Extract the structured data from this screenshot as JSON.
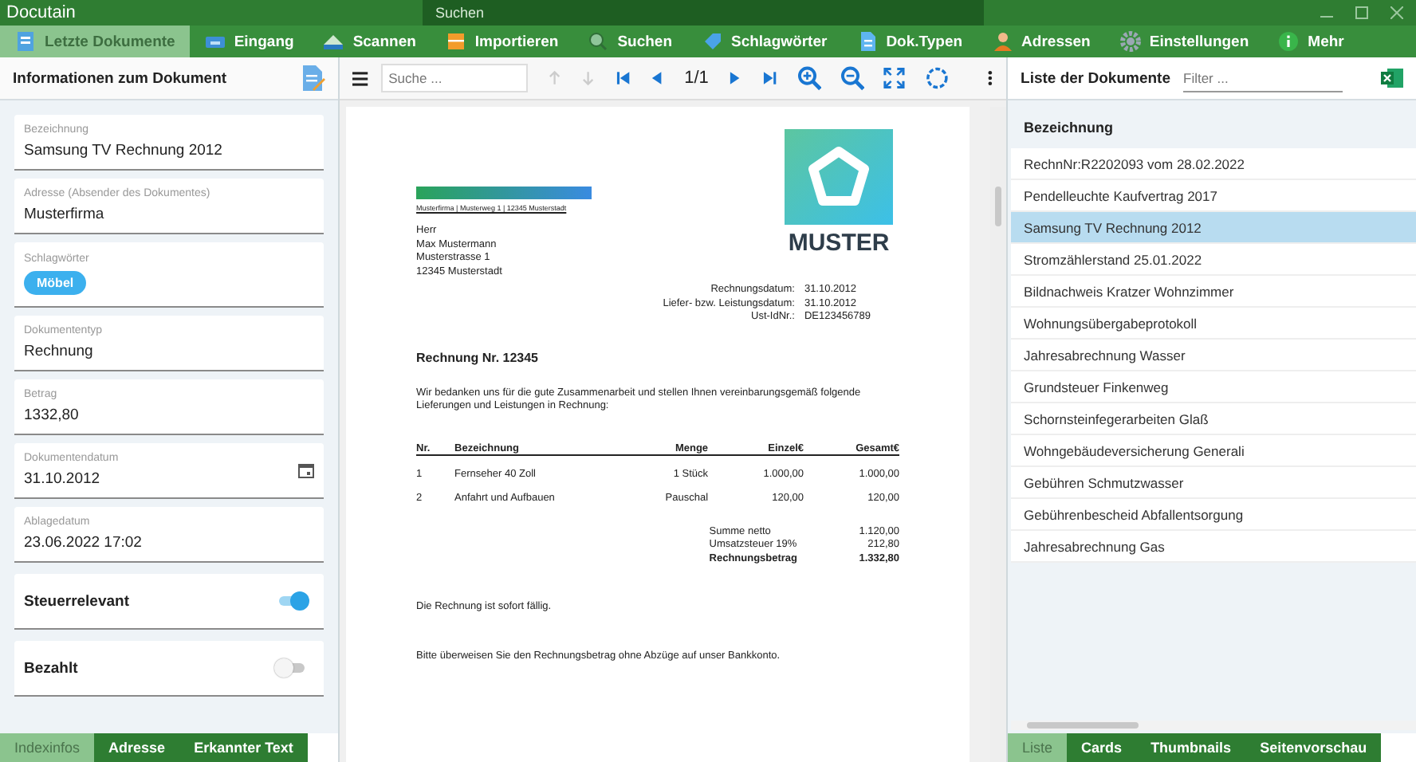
{
  "app": {
    "logo": "Docutain",
    "search_placeholder": "Suchen"
  },
  "menu": [
    {
      "label": "Letzte Dokumente",
      "selected": true
    },
    {
      "label": "Eingang",
      "selected": false
    },
    {
      "label": "Scannen",
      "selected": false
    },
    {
      "label": "Importieren",
      "selected": false
    },
    {
      "label": "Suchen",
      "selected": false
    },
    {
      "label": "Schlagwörter",
      "selected": false
    },
    {
      "label": "Dok.Typen",
      "selected": false
    },
    {
      "label": "Adressen",
      "selected": false
    },
    {
      "label": "Einstellungen",
      "selected": false
    },
    {
      "label": "Mehr",
      "selected": false
    }
  ],
  "info_panel": {
    "title": "Informationen zum Dokument",
    "fields": [
      {
        "kind": "text",
        "label": "Bezeichnung",
        "value": "Samsung TV Rechnung 2012"
      },
      {
        "kind": "text",
        "label": "Adresse (Absender des Dokumentes)",
        "value": "Musterfirma"
      },
      {
        "kind": "tags",
        "label": "Schlagwörter",
        "tags": [
          "Möbel"
        ]
      },
      {
        "kind": "text",
        "label": "Dokumententyp",
        "value": "Rechnung"
      },
      {
        "kind": "text",
        "label": "Betrag",
        "value": "1332,80"
      },
      {
        "kind": "date",
        "label": "Dokumentendatum",
        "value": "31.10.2012"
      },
      {
        "kind": "text",
        "label": "Ablagedatum",
        "value": "23.06.2022 17:02"
      },
      {
        "kind": "switch",
        "label": "Steuerrelevant",
        "on": true
      },
      {
        "kind": "switch",
        "label": "Bezahlt",
        "on": false
      }
    ],
    "tabs": [
      {
        "label": "Indexinfos",
        "selected": true
      },
      {
        "label": "Adresse",
        "selected": false
      },
      {
        "label": "Erkannter Text",
        "selected": false
      }
    ]
  },
  "viewer": {
    "search_placeholder": "Suche ...",
    "page": "1/1",
    "document": {
      "logo_text": "MUSTER",
      "sender_line": "Musterfirma | Musterweg 1 | 12345 Musterstadt",
      "recipient": [
        "Herr",
        "Max Mustermann",
        "Musterstrasse 1",
        "12345 Musterstadt"
      ],
      "meta": [
        {
          "label": "Rechnungsdatum:",
          "value": "31.10.2012"
        },
        {
          "label": "Liefer- bzw. Leistungsdatum:",
          "value": "31.10.2012"
        },
        {
          "label": "Ust-IdNr.:",
          "value": "DE123456789"
        }
      ],
      "heading": "Rechnung Nr. 12345",
      "intro": "Wir bedanken uns für die gute Zusammenarbeit und stellen Ihnen vereinbarungsgemäß folgende Lieferungen und Leistungen in Rechnung:",
      "columns": [
        "Nr.",
        "Bezeichnung",
        "Menge",
        "Einzel€",
        "Gesamt€"
      ],
      "rows": [
        [
          "1",
          "Fernseher 40 Zoll",
          "1 Stück",
          "1.000,00",
          "1.000,00"
        ],
        [
          "2",
          "Anfahrt und Aufbauen",
          "Pauschal",
          "120,00",
          "120,00"
        ]
      ],
      "totals": [
        {
          "label": "Summe netto",
          "value": "1.120,00",
          "kind": "sub"
        },
        {
          "label": "Umsatzsteuer 19%",
          "value": "212,80",
          "kind": "sub"
        },
        {
          "label": "Rechnungsbetrag",
          "value": "1.332,80",
          "kind": "total"
        }
      ],
      "closing": [
        "Die Rechnung ist sofort fällig.",
        "Bitte überweisen Sie den Rechnungsbetrag ohne Abzüge auf unser Bankkonto."
      ]
    }
  },
  "list_panel": {
    "title": "Liste der Dokumente",
    "filter_placeholder": "Filter ...",
    "column": "Bezeichnung",
    "rows": [
      {
        "label": "RechnNr:R2202093 vom 28.02.2022",
        "selected": false
      },
      {
        "label": "Pendelleuchte Kaufvertrag 2017",
        "selected": false
      },
      {
        "label": "Samsung TV Rechnung 2012",
        "selected": true
      },
      {
        "label": "Stromzählerstand 25.01.2022",
        "selected": false
      },
      {
        "label": "Bildnachweis Kratzer Wohnzimmer",
        "selected": false
      },
      {
        "label": "Wohnungsübergabeprotokoll",
        "selected": false
      },
      {
        "label": "Jahresabrechnung Wasser",
        "selected": false
      },
      {
        "label": "Grundsteuer Finkenweg",
        "selected": false
      },
      {
        "label": "Schornsteinfegerarbeiten Glaß",
        "selected": false
      },
      {
        "label": "Wohngebäudeversicherung Generali",
        "selected": false
      },
      {
        "label": "Gebühren Schmutzwasser",
        "selected": false
      },
      {
        "label": "Gebührenbescheid Abfallentsorgung",
        "selected": false
      },
      {
        "label": "Jahresabrechnung Gas",
        "selected": false
      }
    ],
    "tabs": [
      {
        "label": "Liste",
        "selected": true
      },
      {
        "label": "Cards",
        "selected": false
      },
      {
        "label": "Thumbnails",
        "selected": false
      },
      {
        "label": "Seitenvorschau",
        "selected": false
      }
    ]
  }
}
